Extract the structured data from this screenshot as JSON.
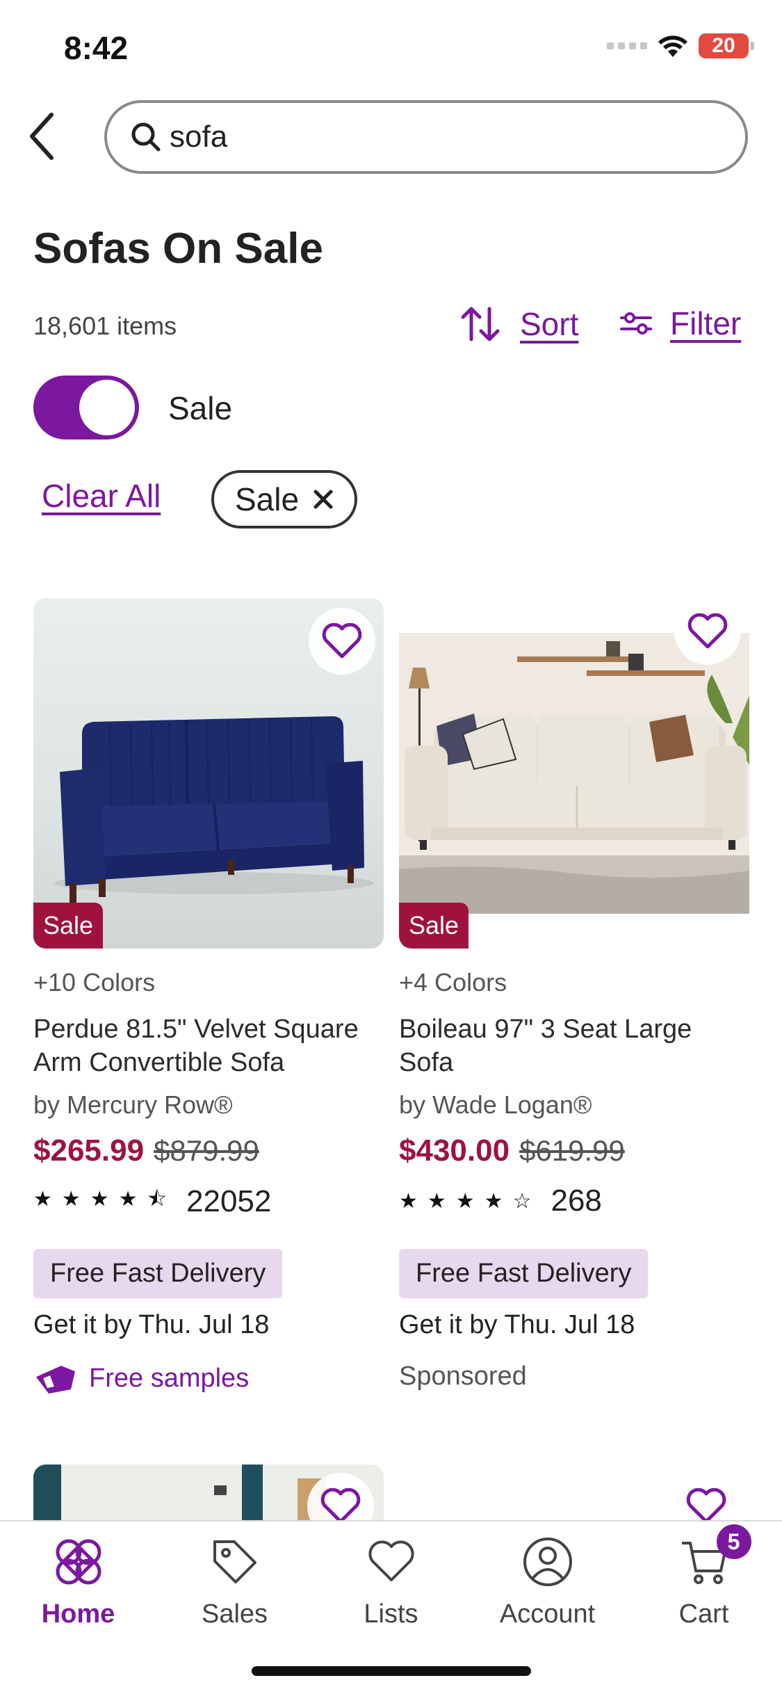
{
  "status_bar": {
    "time": "8:42",
    "battery": "20"
  },
  "search": {
    "query": "sofa"
  },
  "header": {
    "title": "Sofas On Sale",
    "item_count": "18,601 items",
    "sort_label": "Sort",
    "filter_label": "Filter"
  },
  "toggle": {
    "label": "Sale",
    "on": true
  },
  "filters": {
    "clear_all_label": "Clear All",
    "chips": [
      {
        "label": "Sale"
      }
    ]
  },
  "products": [
    {
      "badge": "Sale",
      "colors": "+10 Colors",
      "name": "Perdue 81.5\" Velvet Square Arm Convertible Sofa",
      "brand": "by Mercury Row®",
      "price": "$265.99",
      "was_price": "$879.99",
      "rating": 4.5,
      "rating_count": "22052",
      "delivery_badge": "Free Fast Delivery",
      "delivery_date": "Get it by Thu. Jul 18",
      "extra": "Free samples"
    },
    {
      "badge": "Sale",
      "colors": "+4 Colors",
      "name": "Boileau 97\" 3 Seat Large Sofa",
      "brand": "by Wade Logan®",
      "price": "$430.00",
      "was_price": "$619.99",
      "rating": 4,
      "rating_count": "268",
      "delivery_badge": "Free Fast Delivery",
      "delivery_date": "Get it by Thu. Jul 18",
      "extra": "Sponsored"
    }
  ],
  "bottom_nav": {
    "items": [
      {
        "label": "Home",
        "icon": "home-icon",
        "active": true
      },
      {
        "label": "Sales",
        "icon": "tag-icon"
      },
      {
        "label": "Lists",
        "icon": "heart-icon"
      },
      {
        "label": "Account",
        "icon": "account-icon"
      },
      {
        "label": "Cart",
        "icon": "cart-icon",
        "badge": "5"
      }
    ]
  },
  "colors": {
    "accent": "#7b189f",
    "sale": "#a0123e",
    "delivery_bg": "#e8d8ee"
  }
}
